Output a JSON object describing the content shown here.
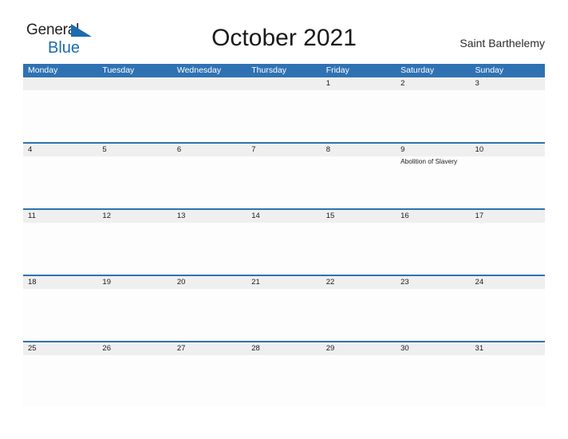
{
  "brand": {
    "word_top": "General",
    "word_bottom": "Blue",
    "top_color": "#231f20",
    "bottom_color": "#1a6cb0",
    "flag_icon": "blue-triangle-flag-icon"
  },
  "header": {
    "title": "October 2021",
    "region": "Saint Barthelemy"
  },
  "theme": {
    "header_blue": "#2f72b3",
    "row_divider_blue": "#2f72b3",
    "date_band_gray": "#efefef",
    "cell_white": "#fdfdfd",
    "text_dark": "#1a1a1a"
  },
  "calendar": {
    "weekdays": [
      "Monday",
      "Tuesday",
      "Wednesday",
      "Thursday",
      "Friday",
      "Saturday",
      "Sunday"
    ],
    "weeks": [
      [
        {
          "num": "",
          "events": []
        },
        {
          "num": "",
          "events": []
        },
        {
          "num": "",
          "events": []
        },
        {
          "num": "",
          "events": []
        },
        {
          "num": "1",
          "events": []
        },
        {
          "num": "2",
          "events": []
        },
        {
          "num": "3",
          "events": []
        }
      ],
      [
        {
          "num": "4",
          "events": []
        },
        {
          "num": "5",
          "events": []
        },
        {
          "num": "6",
          "events": []
        },
        {
          "num": "7",
          "events": []
        },
        {
          "num": "8",
          "events": []
        },
        {
          "num": "9",
          "events": [
            "Abolition of Slavery"
          ]
        },
        {
          "num": "10",
          "events": []
        }
      ],
      [
        {
          "num": "11",
          "events": []
        },
        {
          "num": "12",
          "events": []
        },
        {
          "num": "13",
          "events": []
        },
        {
          "num": "14",
          "events": []
        },
        {
          "num": "15",
          "events": []
        },
        {
          "num": "16",
          "events": []
        },
        {
          "num": "17",
          "events": []
        }
      ],
      [
        {
          "num": "18",
          "events": []
        },
        {
          "num": "19",
          "events": []
        },
        {
          "num": "20",
          "events": []
        },
        {
          "num": "21",
          "events": []
        },
        {
          "num": "22",
          "events": []
        },
        {
          "num": "23",
          "events": []
        },
        {
          "num": "24",
          "events": []
        }
      ],
      [
        {
          "num": "25",
          "events": []
        },
        {
          "num": "26",
          "events": []
        },
        {
          "num": "27",
          "events": []
        },
        {
          "num": "28",
          "events": []
        },
        {
          "num": "29",
          "events": []
        },
        {
          "num": "30",
          "events": []
        },
        {
          "num": "31",
          "events": []
        }
      ]
    ]
  }
}
